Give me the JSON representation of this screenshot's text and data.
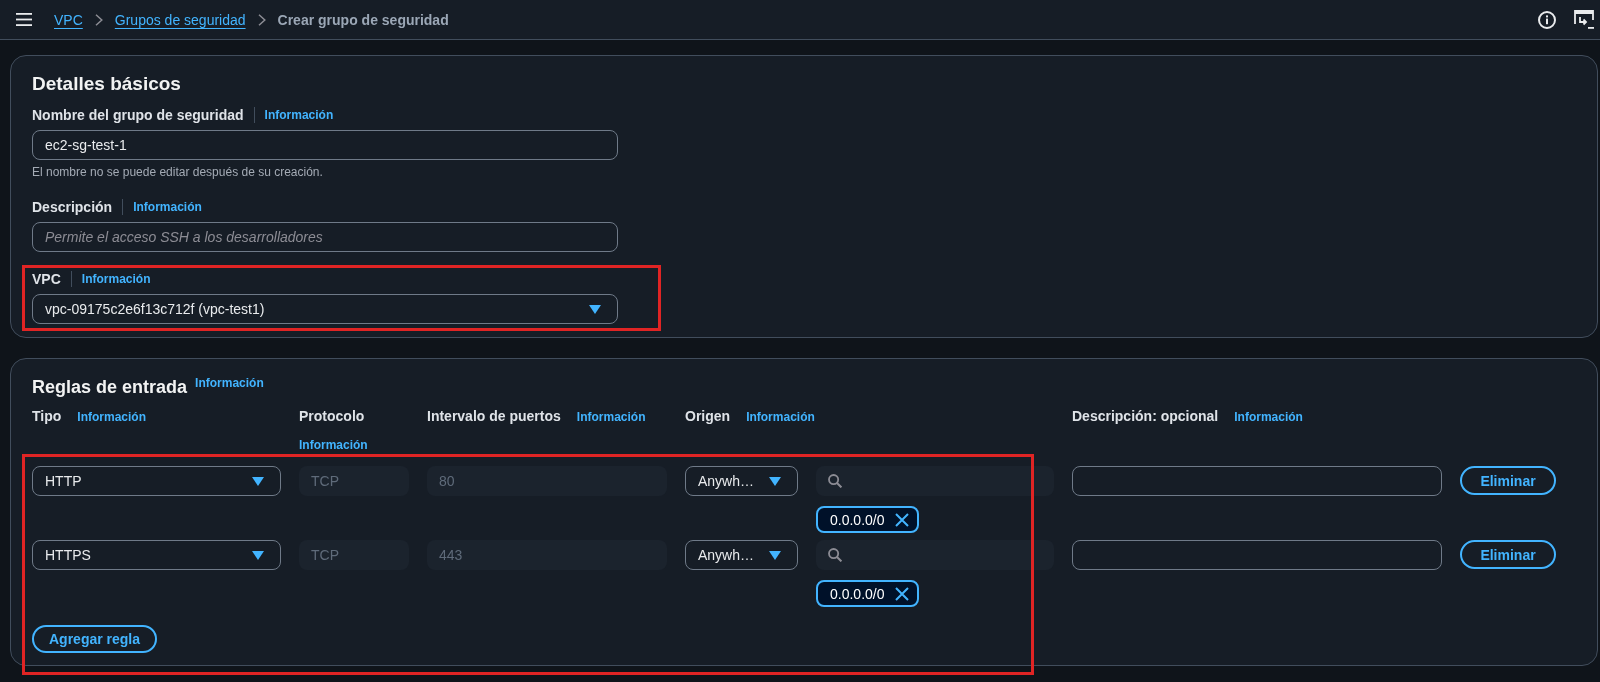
{
  "top_bar": {
    "breadcrumbs": [
      {
        "label": "VPC",
        "kind": "link"
      },
      {
        "label": "Grupos de seguridad",
        "kind": "link"
      },
      {
        "label": "Crear grupo de seguridad",
        "kind": "current"
      }
    ]
  },
  "basic_details": {
    "title": "Detalles básicos",
    "fields": [
      {
        "kind": "text",
        "label": "Nombre del grupo de seguridad",
        "info": "Información",
        "value": "ec2-sg-test-1",
        "hint": "El nombre no se puede editar después de su creación.",
        "highlighted": false
      },
      {
        "kind": "text",
        "label": "Descripción",
        "info": "Información",
        "placeholder": "Permite el acceso SSH a los desarrolladores",
        "highlighted": false
      },
      {
        "kind": "select",
        "label": "VPC",
        "info": "Información",
        "value": "vpc-09175c2e6f13c712f (vpc-test1)",
        "highlighted": true
      }
    ]
  },
  "inbound_rules": {
    "title": "Reglas de entrada",
    "info": "Información",
    "columns": [
      {
        "label": "Tipo",
        "info": "Información"
      },
      {
        "label": "Protocolo",
        "info": "Información"
      },
      {
        "label": "Intervalo de puertos",
        "info": "Información"
      },
      {
        "label": "Origen",
        "info": "Información"
      },
      {
        "label": "Descripción: opcional",
        "info": "Información"
      }
    ],
    "rows": [
      {
        "type": "HTTP",
        "protocol": {
          "value": "TCP",
          "disabled": true
        },
        "port_range": {
          "value": "80",
          "disabled": true
        },
        "source": "Anywh…",
        "sources": [
          "0.0.0.0/0"
        ],
        "delete_button": "Eliminar"
      },
      {
        "type": "HTTPS",
        "protocol": {
          "value": "TCP",
          "disabled": true
        },
        "port_range": {
          "value": "443",
          "disabled": true
        },
        "source": "Anywh…",
        "sources": [
          "0.0.0.0/0"
        ],
        "delete_button": "Eliminar"
      }
    ],
    "add_button": "Agregar regla",
    "highlighted": true
  }
}
